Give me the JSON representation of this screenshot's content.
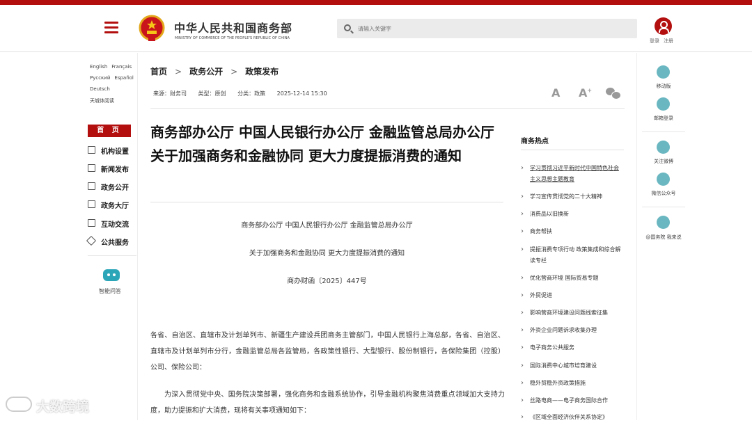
{
  "header": {
    "brand_cn": "中华人民共和国商务部",
    "brand_en": "MINISTRY OF COMMERCE OF THE PEOPLE'S REPUBLIC OF CHINA",
    "search_placeholder": "请输入关键字",
    "login": "登录",
    "register": "注册",
    "accent": "#b30f0f"
  },
  "languages": [
    [
      "English",
      "Français"
    ],
    [
      "Русский",
      "Español"
    ],
    [
      "Deutsch"
    ],
    [
      "天城体阅读"
    ]
  ],
  "left_nav": {
    "home": "首 页",
    "items": [
      "机构设置",
      "新闻发布",
      "政务公开",
      "政务大厅",
      "互动交流",
      "公共服务"
    ],
    "assistant": "智能问答"
  },
  "breadcrumb": [
    "首页",
    "政务公开",
    "政策发布"
  ],
  "meta": {
    "source": "来源：财务司",
    "type": "类型：原创",
    "category": "分类：政策",
    "datetime": "2025-12-14 15:30"
  },
  "font_controls": [
    "A",
    "A"
  ],
  "article": {
    "title": "商务部办公厅 中国人民银行办公厅 金融监管总局办公厅关于加强商务和金融协同 更大力度提振消费的通知",
    "issuers": "商务部办公厅 中国人民银行办公厅 金融监管总局办公厅",
    "doc_title": "关于加强商务和金融协同 更大力度提振消费的通知",
    "doc_no": "商办财函〔2025〕447号",
    "recipients": "各省、自治区、直辖市及计划单列市、新疆生产建设兵团商务主管部门，中国人民银行上海总部，各省、自治区、直辖市及计划单列市分行，金融监管总局各监管局，各政策性银行、大型银行、股份制银行，各保险集团（控股）公司、保险公司：",
    "body": "为深入贯彻党中央、国务院决策部署，强化商务和金融系统协作，引导金融机构聚焦消费重点领域加大支持力度，助力提振和扩大消费，现将有关事项通知如下："
  },
  "hot": {
    "title": "商务热点",
    "items": [
      "学习贯彻习近平新时代中国特色社会主义思想主题教育",
      "学习宣传贯彻党的二十大精神",
      "消费品以旧换新",
      "商务帮扶",
      "提振消费专项行动 政策集成和综合解读专栏",
      "优化营商环境 国际贸易专题",
      "外贸促进",
      "影响营商环境建设问题线索征集",
      "外资企业问题诉求收集办理",
      "电子商务公共服务",
      "国际消费中心城市培育建设",
      "稳外贸稳外资政策措施",
      "丝路电商——电子商务国际合作",
      "《区域全面经济伙伴关系协定》"
    ]
  },
  "right_nav": [
    "移动版",
    "邮箱登录",
    "关注微博",
    "微信公众号",
    "@国务院 我来说"
  ],
  "watermark": "大数跨境"
}
